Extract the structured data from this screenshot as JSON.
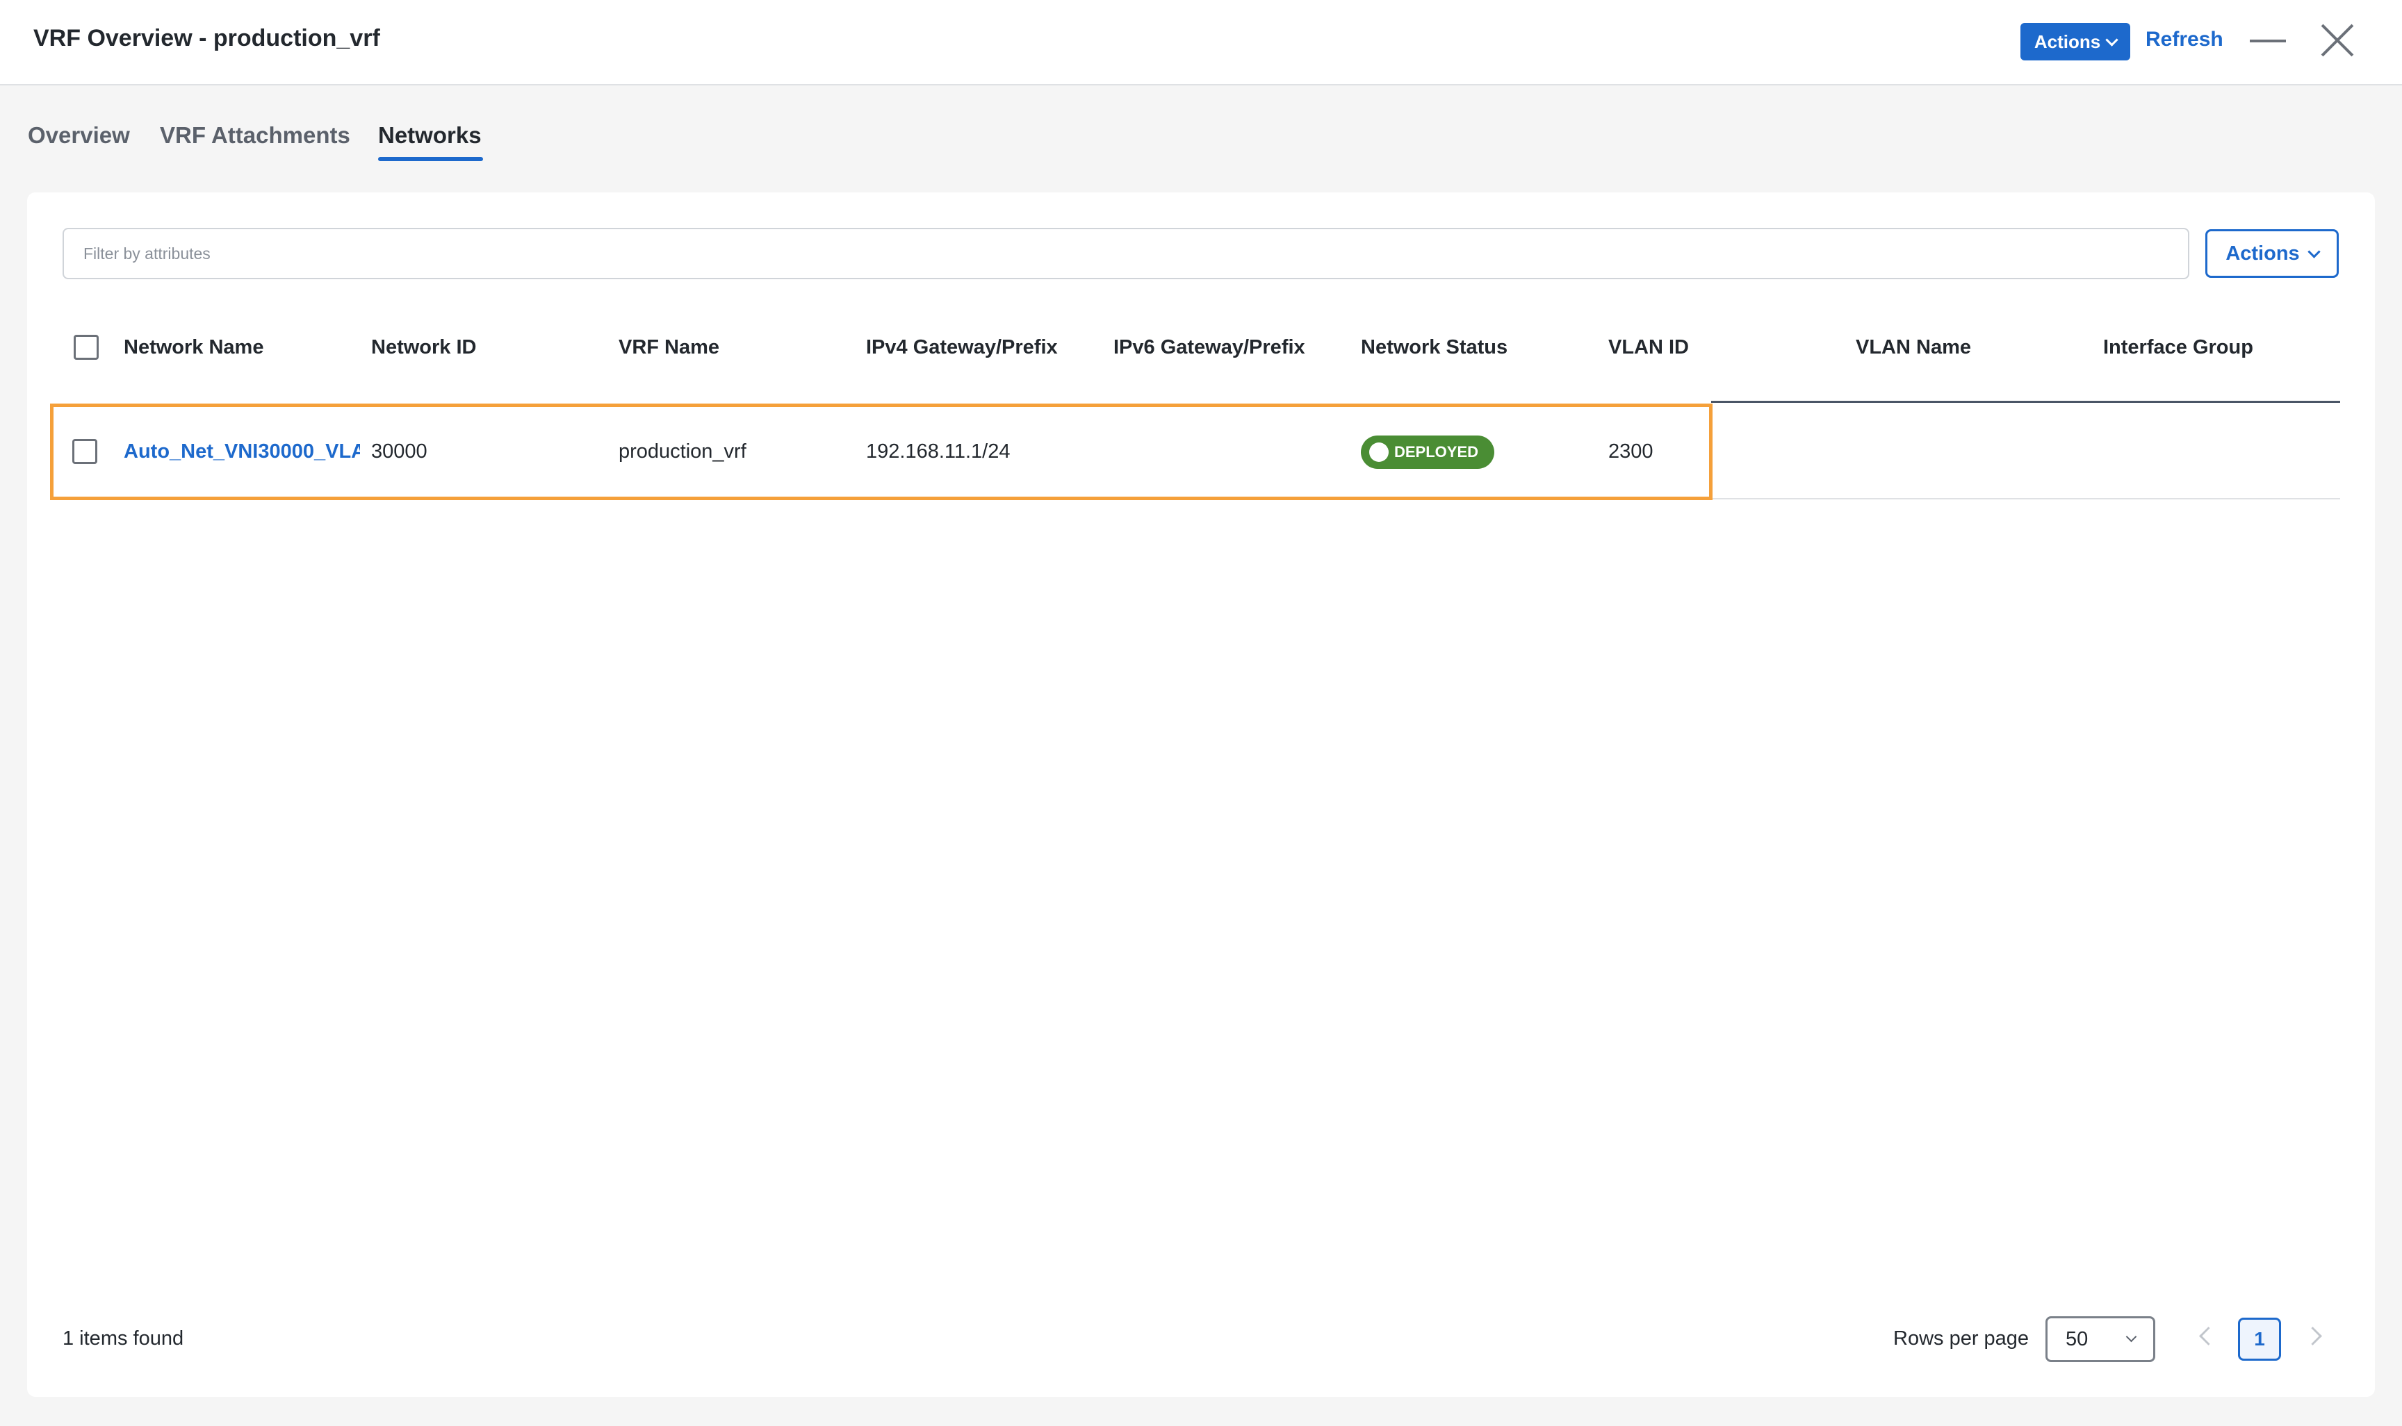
{
  "header": {
    "title": "VRF Overview - production_vrf",
    "actions_label": "Actions",
    "refresh_label": "Refresh"
  },
  "tabs": [
    {
      "label": "Overview",
      "active": false
    },
    {
      "label": "VRF Attachments",
      "active": false
    },
    {
      "label": "Networks",
      "active": true
    }
  ],
  "filter": {
    "placeholder": "Filter by attributes",
    "value": ""
  },
  "table_actions_label": "Actions",
  "table": {
    "columns": [
      "Network Name",
      "Network ID",
      "VRF Name",
      "IPv4 Gateway/Prefix",
      "IPv6 Gateway/Prefix",
      "Network Status",
      "VLAN ID",
      "VLAN Name",
      "Interface Group"
    ],
    "rows": [
      {
        "network_name": "Auto_Net_VNI30000_VLA",
        "network_id": "30000",
        "vrf_name": "production_vrf",
        "ipv4_gateway": "192.168.11.1/24",
        "ipv6_gateway": "",
        "network_status": "DEPLOYED",
        "vlan_id": "2300",
        "vlan_name": "",
        "interface_group": ""
      }
    ]
  },
  "footer": {
    "items_found": "1 items found",
    "rows_per_page_label": "Rows per page",
    "rows_per_page_value": "50",
    "current_page": "1"
  },
  "colors": {
    "accent": "#1d69cc",
    "status_deployed": "#4a8d34",
    "row_highlight": "#f5a03a"
  }
}
